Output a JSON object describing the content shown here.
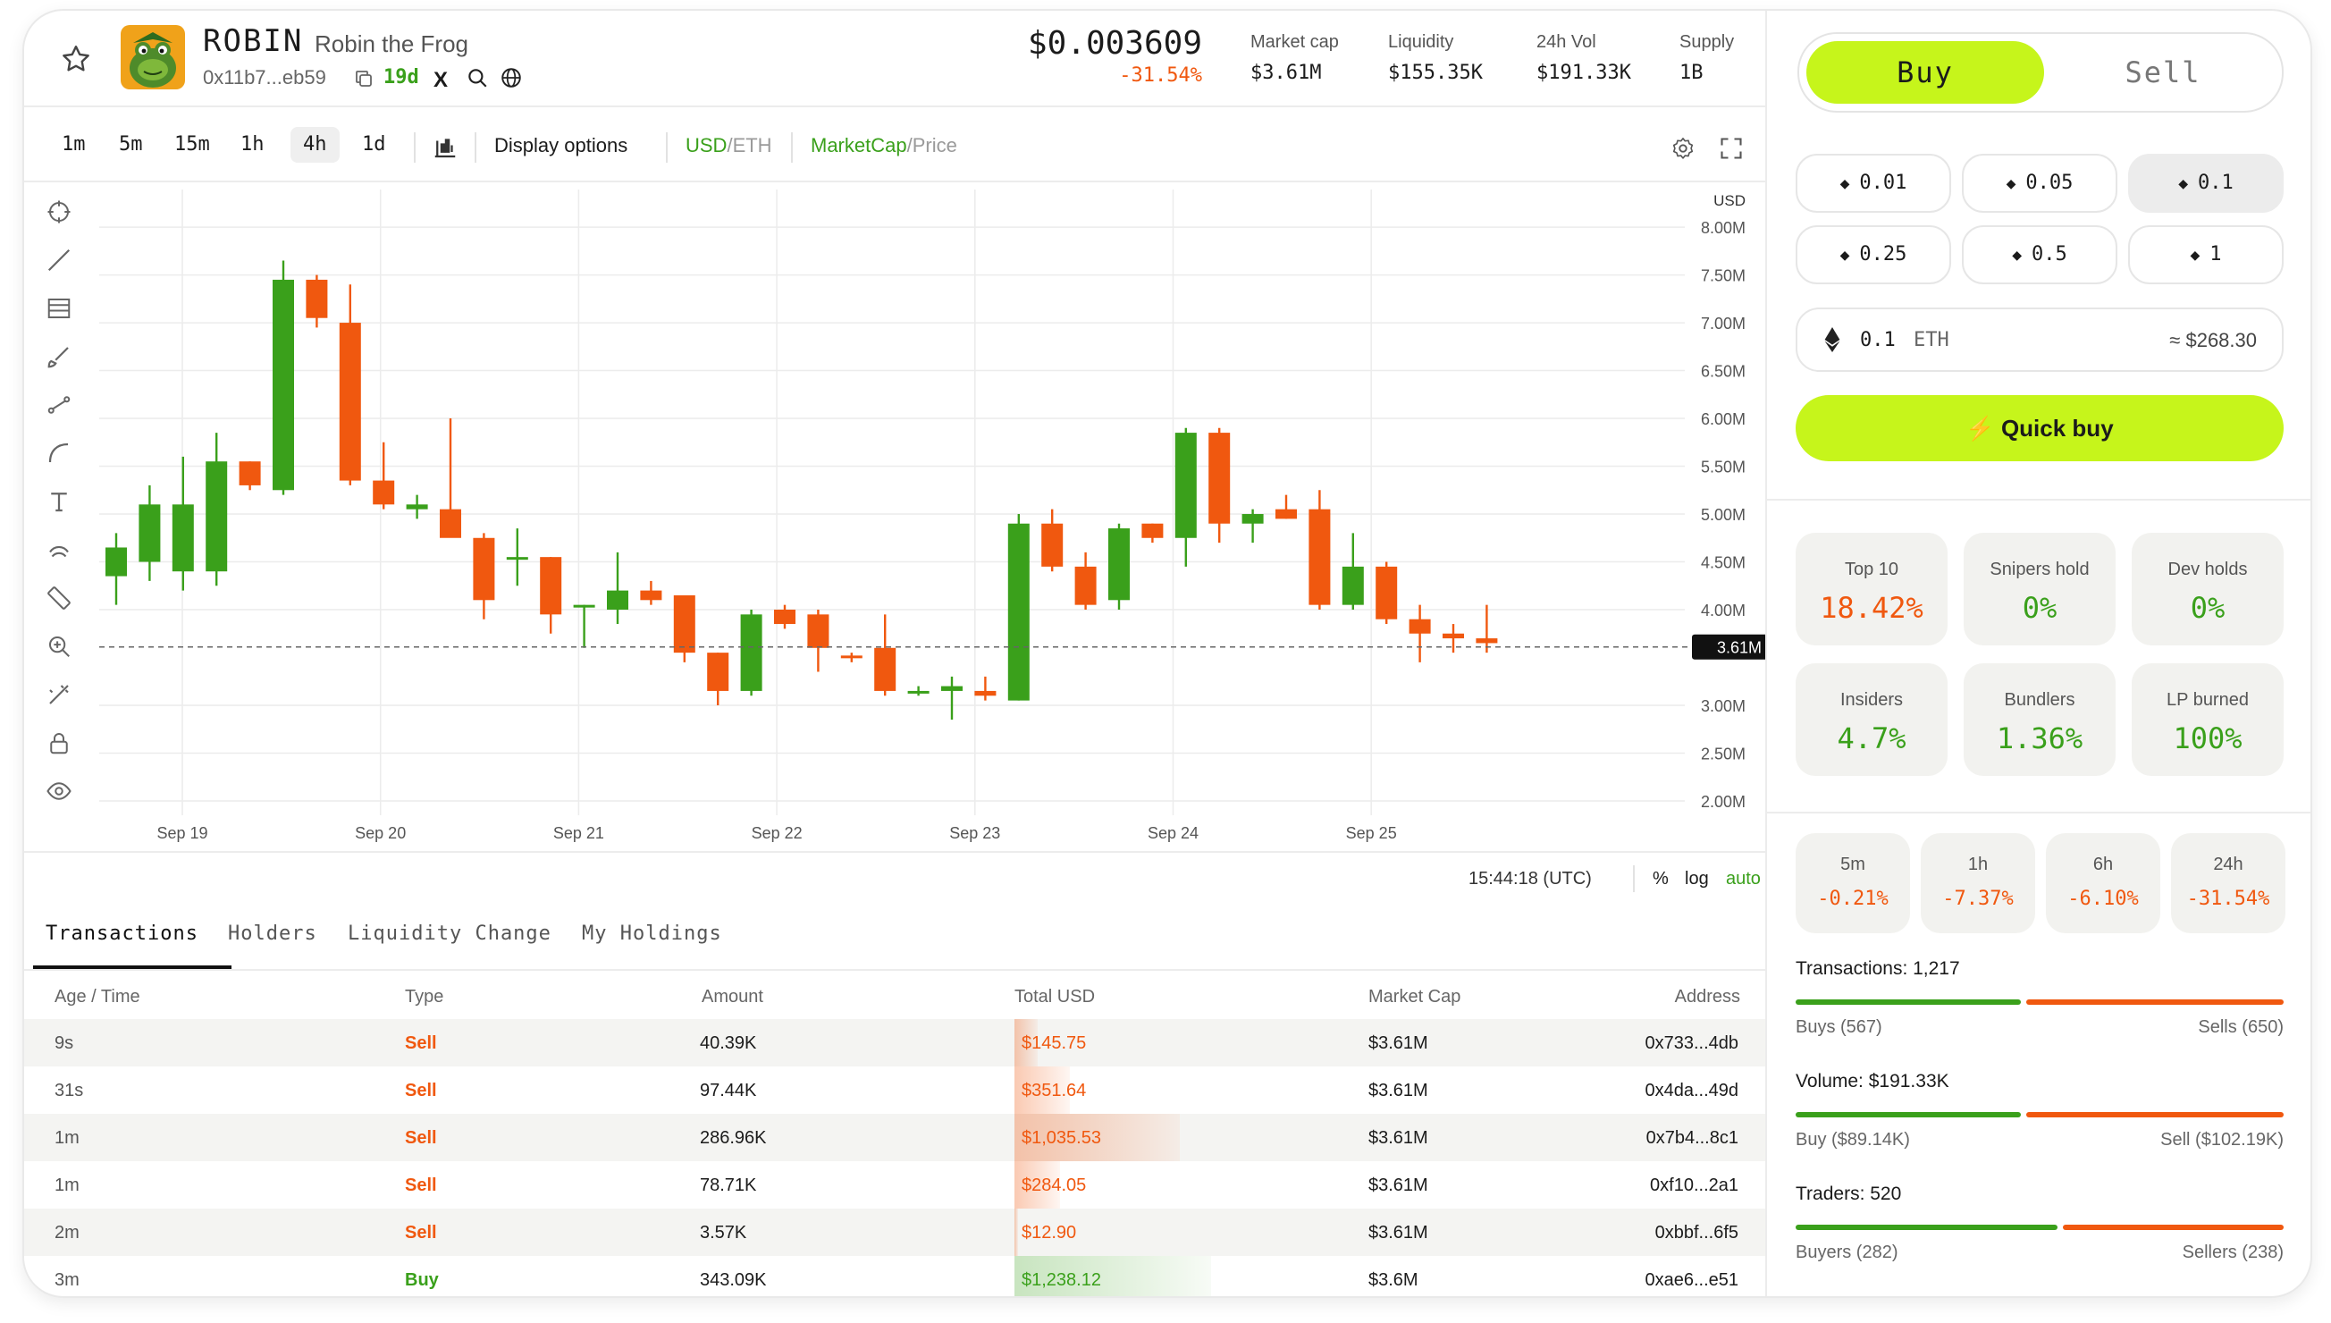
{
  "token": {
    "ticker": "ROBIN",
    "name": "Robin the Frog",
    "address": "0x11b7...eb59",
    "age": "19d",
    "x_glyph": "X",
    "price": "$0.003609",
    "change": "-31.54%"
  },
  "stats": [
    {
      "label": "Market cap",
      "value": "$3.61M"
    },
    {
      "label": "Liquidity",
      "value": "$155.35K"
    },
    {
      "label": "24h Vol",
      "value": "$191.33K"
    },
    {
      "label": "Supply",
      "value": "1B"
    }
  ],
  "toolbar": {
    "timeframes": [
      "1m",
      "5m",
      "15m",
      "1h",
      "4h",
      "1d"
    ],
    "active_timeframe": "4h",
    "display_options": "Display options",
    "currency_active": "USD",
    "currency_sep": "/ETH",
    "mode_active": "MarketCap",
    "mode_sep": "/Price"
  },
  "chart_data": {
    "type": "candlestick",
    "currency_label": "USD",
    "y_ticks": [
      "8.00M",
      "7.50M",
      "7.00M",
      "6.50M",
      "6.00M",
      "5.50M",
      "5.00M",
      "4.50M",
      "4.00M",
      "3.00M",
      "2.50M",
      "2.00M"
    ],
    "ylim": [
      2.0,
      8.0
    ],
    "unit": "M",
    "x_ticks": [
      "Sep 19",
      "Sep 20",
      "Sep 21",
      "Sep 22",
      "Sep 23",
      "Sep 24",
      "Sep 25"
    ],
    "current_value": 3.61,
    "current_label": "3.61M",
    "candles": [
      {
        "o": 4.35,
        "h": 4.8,
        "l": 4.05,
        "c": 4.65
      },
      {
        "o": 4.5,
        "h": 5.3,
        "l": 4.3,
        "c": 5.1
      },
      {
        "o": 4.4,
        "h": 5.6,
        "l": 4.2,
        "c": 5.1
      },
      {
        "o": 4.4,
        "h": 5.85,
        "l": 4.25,
        "c": 5.55
      },
      {
        "o": 5.55,
        "h": 5.55,
        "l": 5.25,
        "c": 5.3
      },
      {
        "o": 5.25,
        "h": 7.65,
        "l": 5.2,
        "c": 7.45
      },
      {
        "o": 7.45,
        "h": 7.5,
        "l": 6.95,
        "c": 7.05
      },
      {
        "o": 7.0,
        "h": 7.4,
        "l": 5.3,
        "c": 5.35
      },
      {
        "o": 5.35,
        "h": 5.75,
        "l": 5.05,
        "c": 5.1
      },
      {
        "o": 5.05,
        "h": 5.2,
        "l": 4.95,
        "c": 5.1
      },
      {
        "o": 5.05,
        "h": 6.0,
        "l": 4.8,
        "c": 4.75
      },
      {
        "o": 4.75,
        "h": 4.8,
        "l": 3.9,
        "c": 4.1
      },
      {
        "o": 4.55,
        "h": 4.85,
        "l": 4.25,
        "c": 4.55
      },
      {
        "o": 4.55,
        "h": 4.55,
        "l": 3.75,
        "c": 3.95
      },
      {
        "o": 4.05,
        "h": 4.05,
        "l": 3.6,
        "c": 4.05
      },
      {
        "o": 4.0,
        "h": 4.6,
        "l": 3.85,
        "c": 4.2
      },
      {
        "o": 4.2,
        "h": 4.3,
        "l": 4.05,
        "c": 4.1
      },
      {
        "o": 4.15,
        "h": 4.15,
        "l": 3.45,
        "c": 3.55
      },
      {
        "o": 3.55,
        "h": 3.55,
        "l": 3.0,
        "c": 3.15
      },
      {
        "o": 3.15,
        "h": 4.0,
        "l": 3.1,
        "c": 3.95
      },
      {
        "o": 4.0,
        "h": 4.05,
        "l": 3.8,
        "c": 3.85
      },
      {
        "o": 3.95,
        "h": 4.0,
        "l": 3.35,
        "c": 3.6
      },
      {
        "o": 3.52,
        "h": 3.55,
        "l": 3.45,
        "c": 3.5
      },
      {
        "o": 3.6,
        "h": 3.95,
        "l": 3.1,
        "c": 3.15
      },
      {
        "o": 3.15,
        "h": 3.2,
        "l": 3.1,
        "c": 3.15
      },
      {
        "o": 3.15,
        "h": 3.3,
        "l": 2.85,
        "c": 3.2
      },
      {
        "o": 3.15,
        "h": 3.3,
        "l": 3.05,
        "c": 3.1
      },
      {
        "o": 3.05,
        "h": 5.0,
        "l": 3.05,
        "c": 4.9
      },
      {
        "o": 4.9,
        "h": 5.05,
        "l": 4.4,
        "c": 4.45
      },
      {
        "o": 4.45,
        "h": 4.6,
        "l": 4.0,
        "c": 4.05
      },
      {
        "o": 4.1,
        "h": 4.9,
        "l": 4.0,
        "c": 4.85
      },
      {
        "o": 4.9,
        "h": 4.9,
        "l": 4.7,
        "c": 4.75
      },
      {
        "o": 4.75,
        "h": 5.9,
        "l": 4.45,
        "c": 5.85
      },
      {
        "o": 5.85,
        "h": 5.9,
        "l": 4.7,
        "c": 4.9
      },
      {
        "o": 4.9,
        "h": 5.05,
        "l": 4.7,
        "c": 5.0
      },
      {
        "o": 5.05,
        "h": 5.2,
        "l": 4.95,
        "c": 4.95
      },
      {
        "o": 5.05,
        "h": 5.25,
        "l": 4.0,
        "c": 4.05
      },
      {
        "o": 4.05,
        "h": 4.8,
        "l": 4.0,
        "c": 4.45
      },
      {
        "o": 4.45,
        "h": 4.5,
        "l": 3.85,
        "c": 3.9
      },
      {
        "o": 3.9,
        "h": 4.05,
        "l": 3.45,
        "c": 3.75
      },
      {
        "o": 3.75,
        "h": 3.85,
        "l": 3.55,
        "c": 3.7
      },
      {
        "o": 3.7,
        "h": 4.05,
        "l": 3.55,
        "c": 3.65
      }
    ]
  },
  "chart_footer": {
    "time": "15:44:18 (UTC)",
    "percent": "%",
    "log": "log",
    "auto": "auto"
  },
  "tabs": [
    "Transactions",
    "Holders",
    "Liquidity Change",
    "My Holdings"
  ],
  "table": {
    "headers": [
      "Age / Time",
      "Type",
      "Amount",
      "Total USD",
      "Market Cap",
      "Address"
    ],
    "rows": [
      {
        "age": "9s",
        "type": "Sell",
        "amount": "40.39K",
        "total": "$145.75",
        "mcap": "$3.61M",
        "address": "0x733...4db",
        "fill": 0.12
      },
      {
        "age": "31s",
        "type": "Sell",
        "amount": "97.44K",
        "total": "$351.64",
        "mcap": "$3.61M",
        "address": "0x4da...49d",
        "fill": 0.28
      },
      {
        "age": "1m",
        "type": "Sell",
        "amount": "286.96K",
        "total": "$1,035.53",
        "mcap": "$3.61M",
        "address": "0x7b4...8c1",
        "fill": 0.84
      },
      {
        "age": "1m",
        "type": "Sell",
        "amount": "78.71K",
        "total": "$284.05",
        "mcap": "$3.61M",
        "address": "0xf10...2a1",
        "fill": 0.23
      },
      {
        "age": "2m",
        "type": "Sell",
        "amount": "3.57K",
        "total": "$12.90",
        "mcap": "$3.61M",
        "address": "0xbbf...6f5",
        "fill": 0.02
      },
      {
        "age": "3m",
        "type": "Buy",
        "amount": "343.09K",
        "total": "$1,238.12",
        "mcap": "$3.6M",
        "address": "0xae6...e51",
        "fill": 1.0
      }
    ]
  },
  "trade": {
    "buy_label": "Buy",
    "sell_label": "Sell",
    "amounts": [
      "0.01",
      "0.05",
      "0.1",
      "0.25",
      "0.5",
      "1"
    ],
    "selected_amount": "0.1",
    "input_value": "0.1",
    "input_unit": "ETH",
    "input_usd": "≈ $268.30",
    "quick_buy": "Quick buy"
  },
  "metrics": [
    {
      "label": "Top 10",
      "value": "18.42%",
      "tone": "orange"
    },
    {
      "label": "Snipers hold",
      "value": "0%",
      "tone": "green"
    },
    {
      "label": "Dev holds",
      "value": "0%",
      "tone": "green"
    },
    {
      "label": "Insiders",
      "value": "4.7%",
      "tone": "green"
    },
    {
      "label": "Bundlers",
      "value": "1.36%",
      "tone": "green"
    },
    {
      "label": "LP burned",
      "value": "100%",
      "tone": "green"
    }
  ],
  "periods": [
    {
      "label": "5m",
      "value": "-0.21%"
    },
    {
      "label": "1h",
      "value": "-7.37%"
    },
    {
      "label": "6h",
      "value": "-6.10%"
    },
    {
      "label": "24h",
      "value": "-31.54%"
    }
  ],
  "activity": [
    {
      "title": "Transactions: 1,217",
      "left": "Buys (567)",
      "right": "Sells (650)",
      "ratio": 0.466
    },
    {
      "title": "Volume: $191.33K",
      "left": "Buy ($89.14K)",
      "right": "Sell ($102.19K)",
      "ratio": 0.466
    },
    {
      "title": "Traders: 520",
      "left": "Buyers (282)",
      "right": "Sellers (238)",
      "ratio": 0.542
    }
  ],
  "colors": {
    "accent": "#c6f51b",
    "up": "#3aa01b",
    "down": "#f0580f"
  }
}
